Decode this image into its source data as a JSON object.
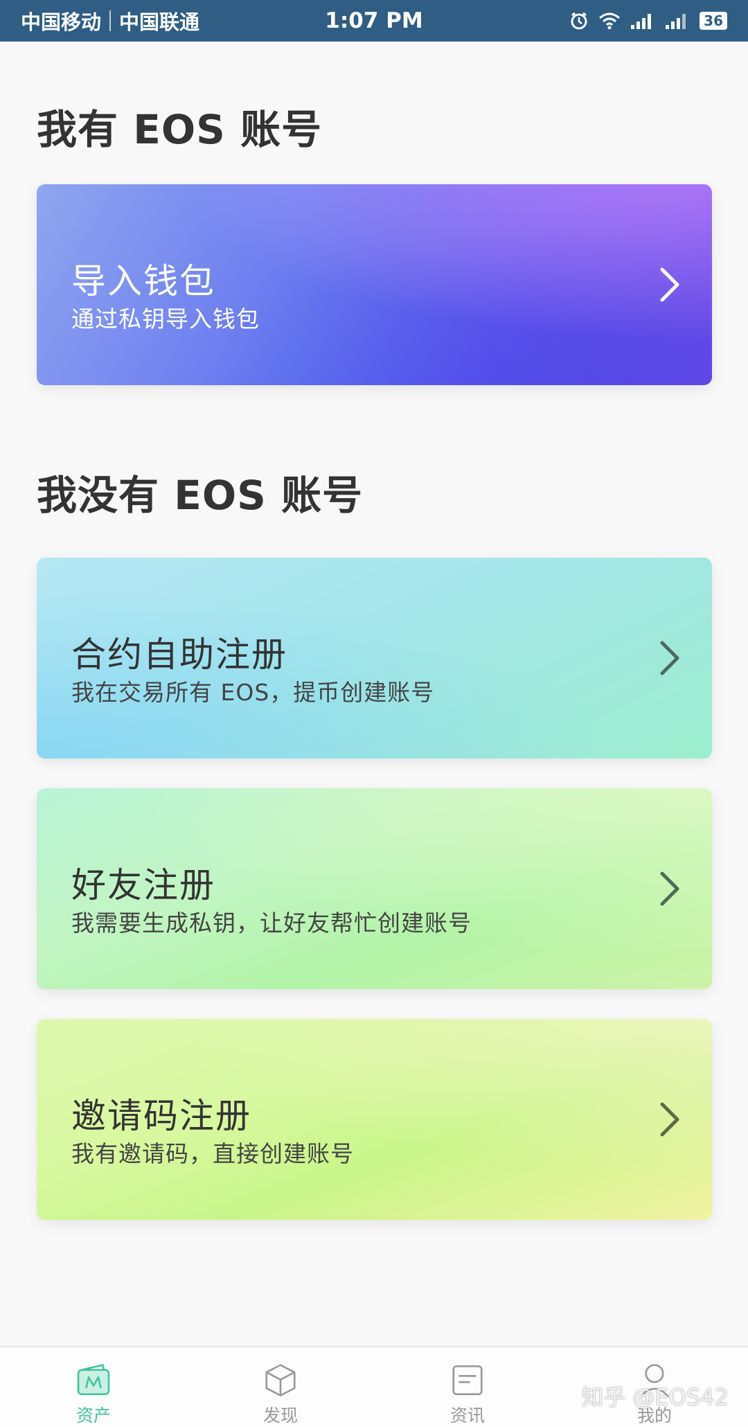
{
  "status_bar": {
    "carrier1": "中国移动",
    "carrier2": "中国联通",
    "time": "1:07 PM",
    "battery": "36"
  },
  "sections": {
    "have_account_title": "我有 EOS 账号",
    "no_account_title": "我没有 EOS 账号"
  },
  "cards": {
    "import": {
      "title": "导入钱包",
      "subtitle": "通过私钥导入钱包"
    },
    "contract": {
      "title": "合约自助注册",
      "subtitle": "我在交易所有 EOS，提币创建账号"
    },
    "friend": {
      "title": "好友注册",
      "subtitle": "我需要生成私钥，让好友帮忙创建账号"
    },
    "invite": {
      "title": "邀请码注册",
      "subtitle": "我有邀请码，直接创建账号"
    }
  },
  "bottom_nav": [
    {
      "label": "资产",
      "icon": "wallet-icon",
      "active": true
    },
    {
      "label": "发现",
      "icon": "cube-icon",
      "active": false
    },
    {
      "label": "资讯",
      "icon": "news-icon",
      "active": false
    },
    {
      "label": "我的",
      "icon": "profile-icon",
      "active": false
    }
  ],
  "watermark": "知乎 @EOS42",
  "colors": {
    "status_bar": "#2f5d83",
    "active_nav": "#44c4a0",
    "inactive_nav": "#999999"
  }
}
